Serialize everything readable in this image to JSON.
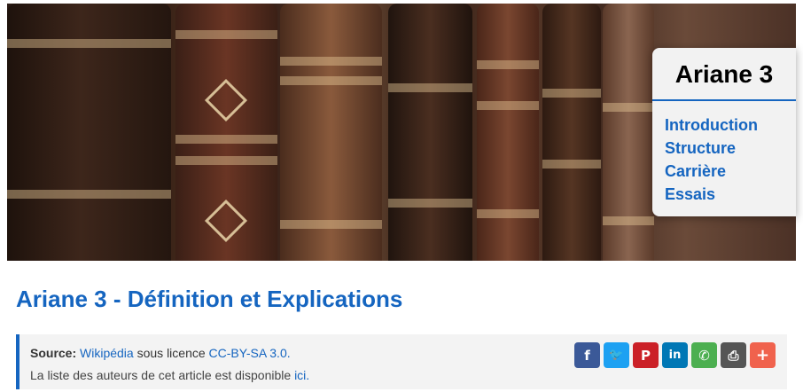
{
  "toc": {
    "title": "Ariane 3",
    "items": [
      {
        "label": "Introduction"
      },
      {
        "label": "Structure"
      },
      {
        "label": "Carrière"
      },
      {
        "label": "Essais"
      }
    ]
  },
  "article": {
    "title": "Ariane 3 - Définition et Explications"
  },
  "source": {
    "label": "Source:",
    "site": "Wikipédia",
    "licence_text": "sous licence",
    "licence": "CC-BY-SA 3.0.",
    "authors_text": "La liste des auteurs de cet article est disponible",
    "authors_link": "ici."
  },
  "share": {
    "buttons": [
      {
        "icon": "facebook-icon",
        "glyph": "f",
        "color": "#3b5998"
      },
      {
        "icon": "twitter-icon",
        "glyph": "🐦",
        "color": "#1da1f2"
      },
      {
        "icon": "pinterest-icon",
        "glyph": "P",
        "color": "#cb2027"
      },
      {
        "icon": "linkedin-icon",
        "glyph": "in",
        "color": "#0077b5"
      },
      {
        "icon": "whatsapp-icon",
        "glyph": "✆",
        "color": "#4caf50"
      },
      {
        "icon": "print-icon",
        "glyph": "⎙",
        "color": "#555555"
      },
      {
        "icon": "plus-icon",
        "glyph": "+",
        "color": "#f0624d"
      }
    ]
  }
}
